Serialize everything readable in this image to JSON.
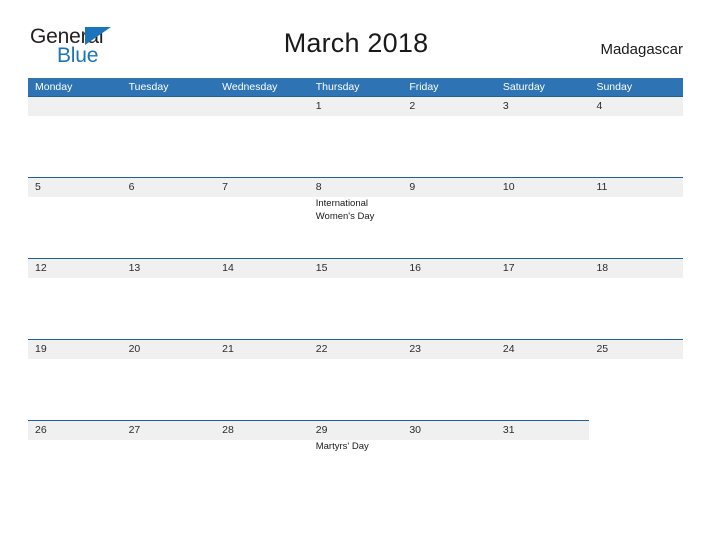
{
  "brand": {
    "name_part1": "General",
    "name_part2": "Blue",
    "triangle_icon": "triangle-icon",
    "color_dark": "#231f20",
    "color_blue": "#1b75bb"
  },
  "header": {
    "title": "March 2018",
    "location": "Madagascar"
  },
  "calendar": {
    "header_color": "#2e74b5",
    "band_color": "#f0f0f0",
    "rule_color": "#1f6099",
    "weekdays": [
      "Monday",
      "Tuesday",
      "Wednesday",
      "Thursday",
      "Friday",
      "Saturday",
      "Sunday"
    ],
    "weeks": [
      {
        "band_columns": 7,
        "days": [
          {
            "number": "",
            "event": ""
          },
          {
            "number": "",
            "event": ""
          },
          {
            "number": "",
            "event": ""
          },
          {
            "number": "1",
            "event": ""
          },
          {
            "number": "2",
            "event": ""
          },
          {
            "number": "3",
            "event": ""
          },
          {
            "number": "4",
            "event": ""
          }
        ]
      },
      {
        "band_columns": 7,
        "days": [
          {
            "number": "5",
            "event": ""
          },
          {
            "number": "6",
            "event": ""
          },
          {
            "number": "7",
            "event": ""
          },
          {
            "number": "8",
            "event": "International Women's Day"
          },
          {
            "number": "9",
            "event": ""
          },
          {
            "number": "10",
            "event": ""
          },
          {
            "number": "11",
            "event": ""
          }
        ]
      },
      {
        "band_columns": 7,
        "days": [
          {
            "number": "12",
            "event": ""
          },
          {
            "number": "13",
            "event": ""
          },
          {
            "number": "14",
            "event": ""
          },
          {
            "number": "15",
            "event": ""
          },
          {
            "number": "16",
            "event": ""
          },
          {
            "number": "17",
            "event": ""
          },
          {
            "number": "18",
            "event": ""
          }
        ]
      },
      {
        "band_columns": 7,
        "days": [
          {
            "number": "19",
            "event": ""
          },
          {
            "number": "20",
            "event": ""
          },
          {
            "number": "21",
            "event": ""
          },
          {
            "number": "22",
            "event": ""
          },
          {
            "number": "23",
            "event": ""
          },
          {
            "number": "24",
            "event": ""
          },
          {
            "number": "25",
            "event": ""
          }
        ]
      },
      {
        "band_columns": 6,
        "days": [
          {
            "number": "26",
            "event": ""
          },
          {
            "number": "27",
            "event": ""
          },
          {
            "number": "28",
            "event": ""
          },
          {
            "number": "29",
            "event": "Martyrs' Day"
          },
          {
            "number": "30",
            "event": ""
          },
          {
            "number": "31",
            "event": ""
          },
          {
            "number": "",
            "event": ""
          }
        ]
      }
    ]
  }
}
